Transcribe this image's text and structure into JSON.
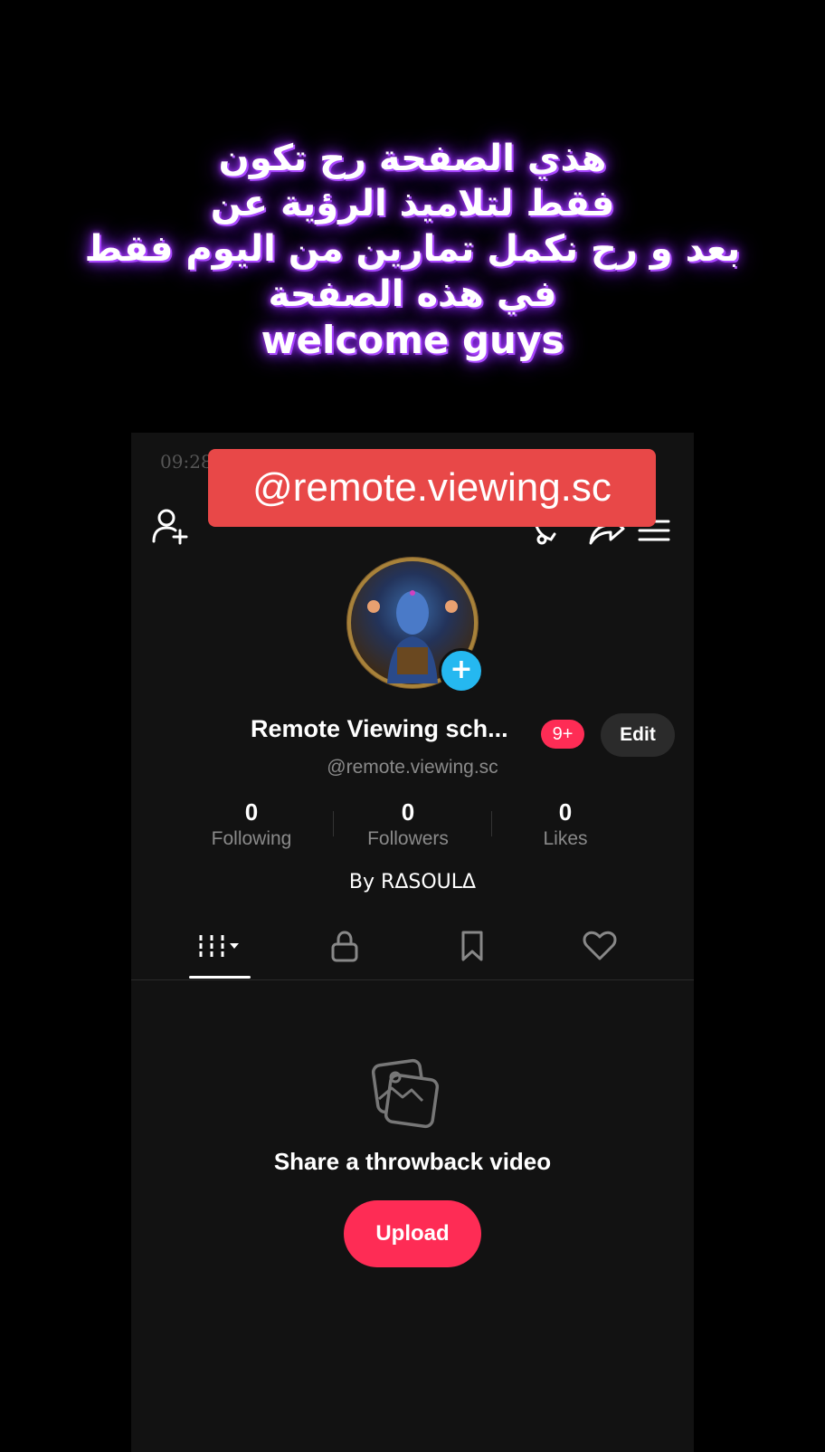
{
  "overlay": {
    "lines": [
      "هذي الصفحة رح تكون",
      "فقط لتلاميذ الرؤية عن",
      "بعد و رح نكمل تمارين من اليوم فقط",
      "في هذه الصفحة",
      "welcome guys"
    ]
  },
  "status": {
    "time": "09:28"
  },
  "banner": {
    "username": "@remote.viewing.sc"
  },
  "profile": {
    "display_name": "Remote Viewing sch...",
    "notification_badge": "9+",
    "edit_label": "Edit",
    "handle": "@remote.viewing.sc",
    "bio": "By RΔSOULΔ"
  },
  "stats": [
    {
      "value": "0",
      "label": "Following"
    },
    {
      "value": "0",
      "label": "Followers"
    },
    {
      "value": "0",
      "label": "Likes"
    }
  ],
  "tabs": [
    {
      "icon": "grid-icon"
    },
    {
      "icon": "lock-icon"
    },
    {
      "icon": "bookmark-icon"
    },
    {
      "icon": "heart-icon"
    }
  ],
  "empty_state": {
    "icon": "photos-icon",
    "message": "Share a throwback video",
    "upload_label": "Upload"
  },
  "colors": {
    "accent": "#fe2c55",
    "banner": "#e84848",
    "badge_plus": "#25b8f0",
    "background": "#121212"
  }
}
